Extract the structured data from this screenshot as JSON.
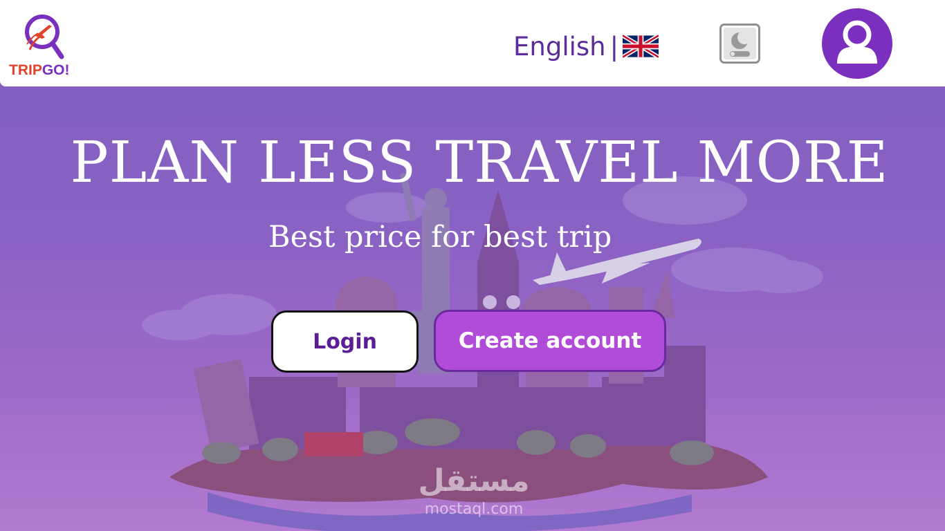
{
  "header": {
    "logo": {
      "text_part1": "TRIP",
      "text_part2": "GO!",
      "icon": "plane-magnifier-logo-icon"
    },
    "language": {
      "label": "English",
      "separator": "|",
      "flag_icon": "uk-flag-icon"
    },
    "theme_toggle": {
      "icon": "moon-toggle-icon"
    },
    "profile": {
      "icon": "user-avatar-icon"
    }
  },
  "hero": {
    "title": "PLAN LESS TRAVEL MORE",
    "subtitle": "Best price for best trip",
    "login_label": "Login",
    "create_account_label": "Create account"
  },
  "watermark": {
    "arabic": "مستقل",
    "latin": "mostaql.com"
  },
  "colors": {
    "brand_purple": "#7b2fbe",
    "accent_button": "#b14cd9",
    "logo_red": "#e0432c",
    "text_purple": "#5b2d9b"
  }
}
